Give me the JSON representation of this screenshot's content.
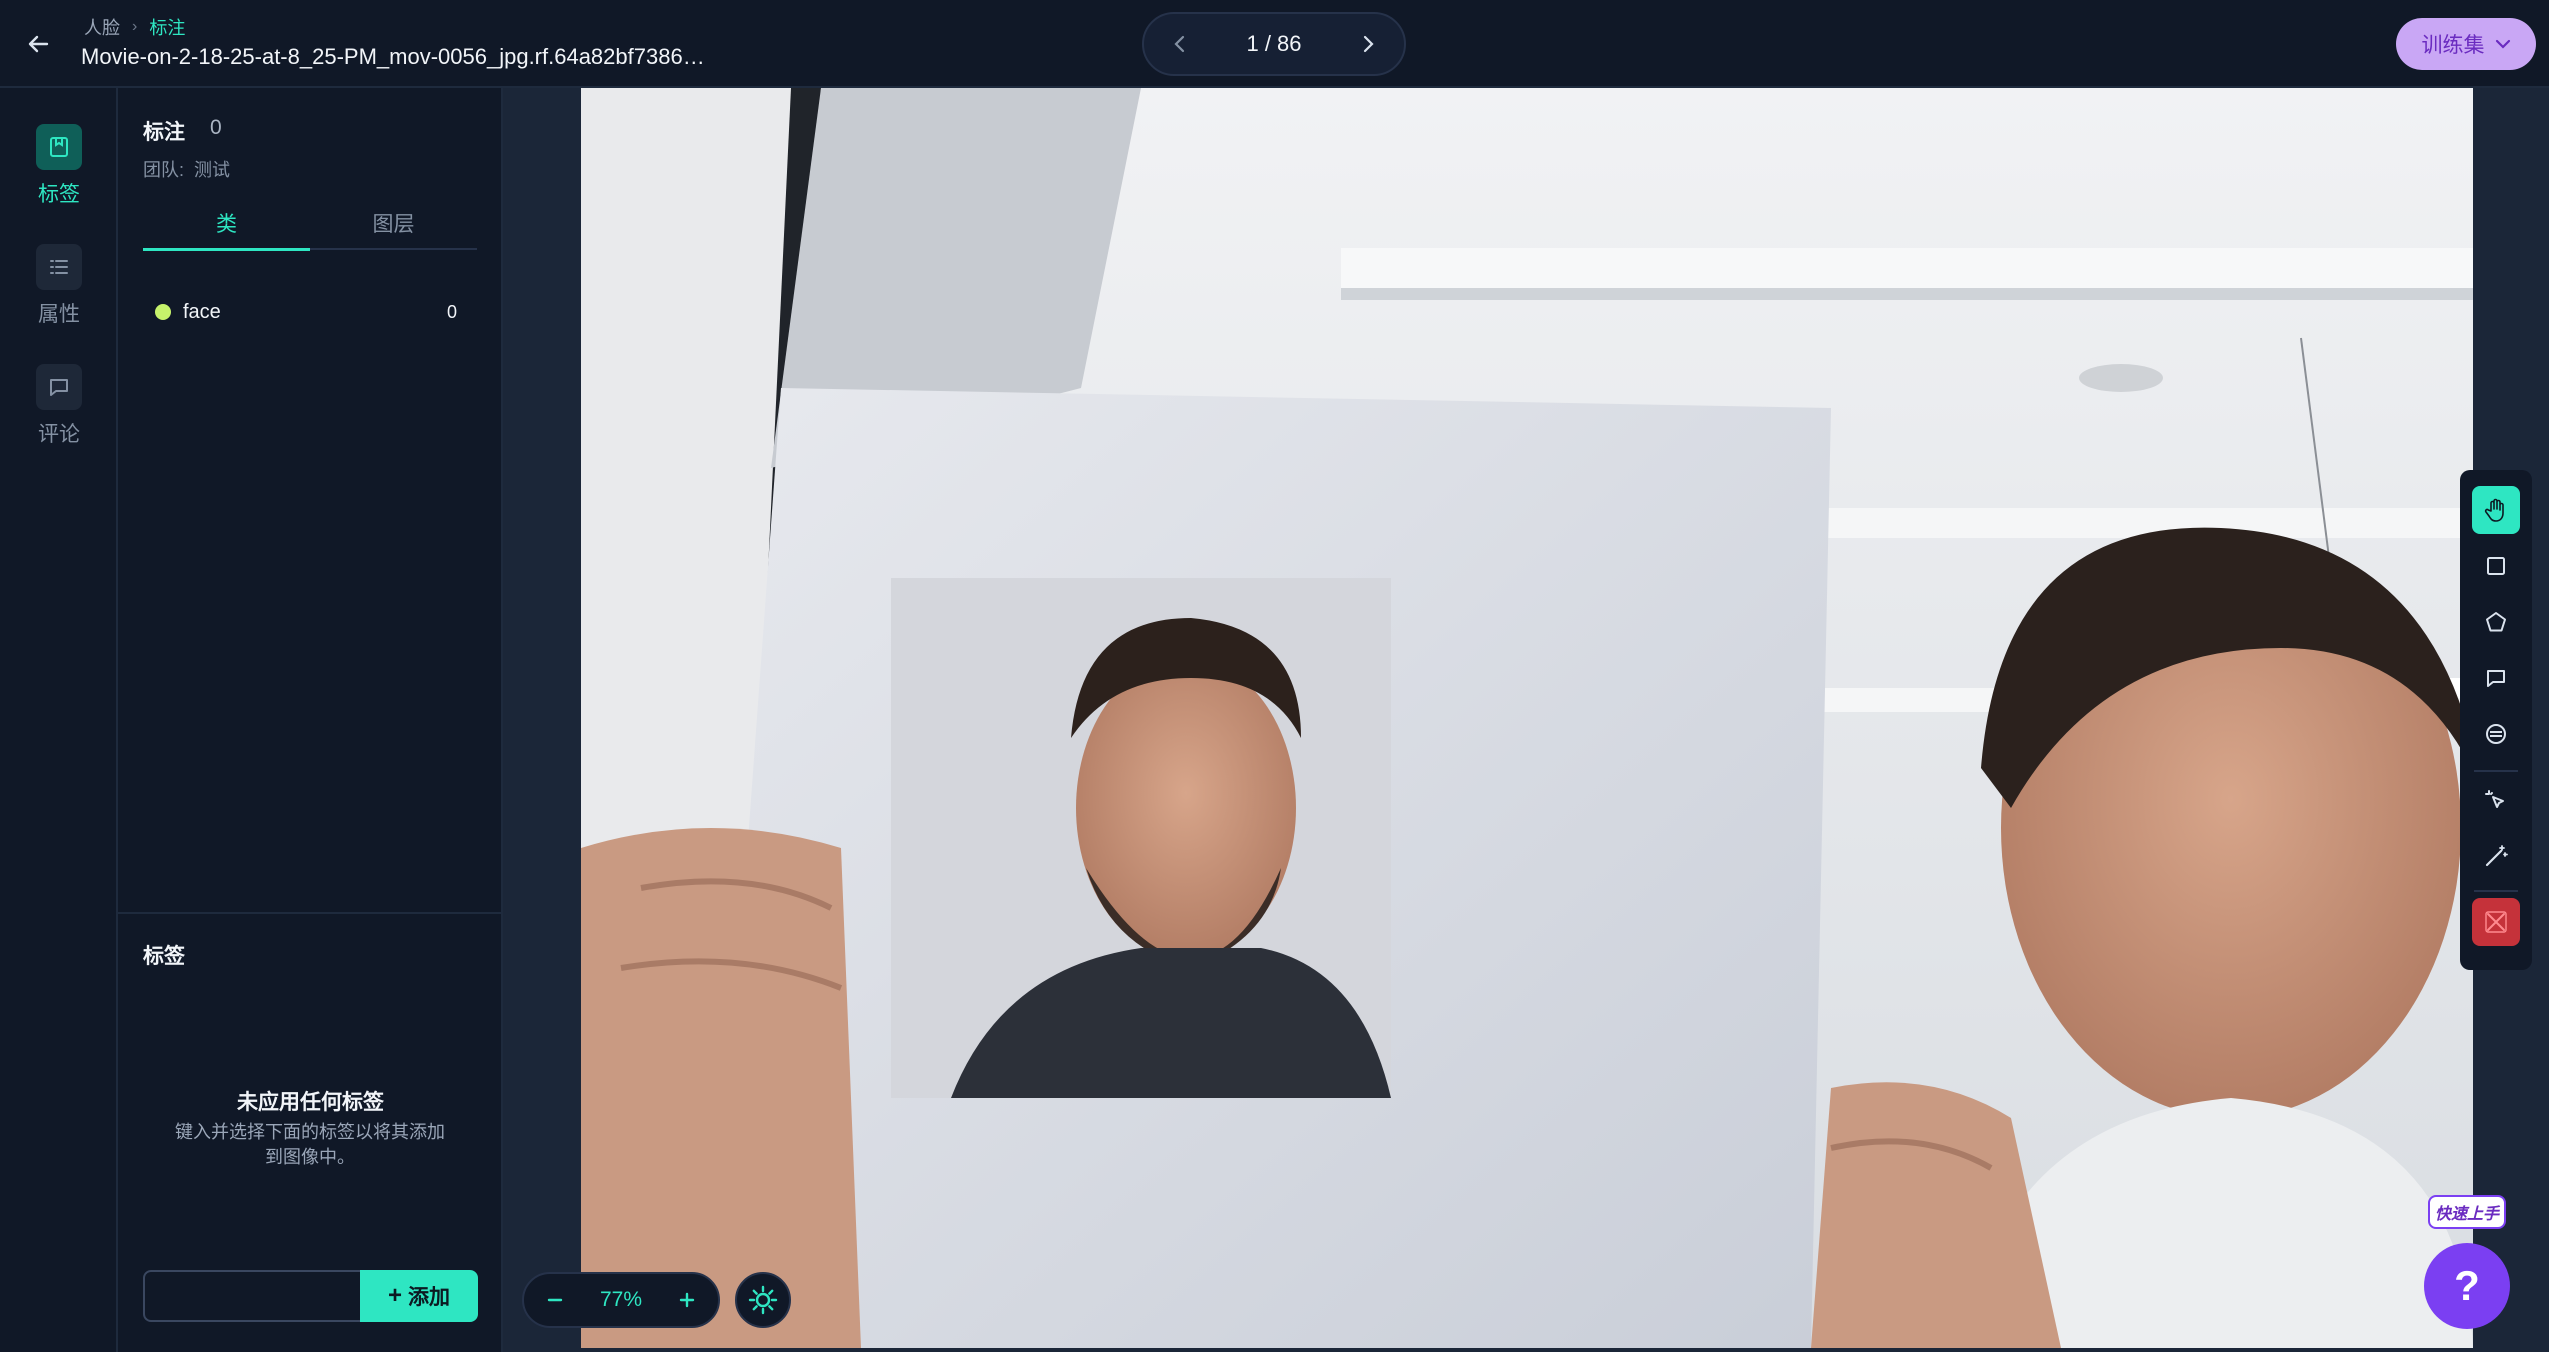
{
  "header": {
    "breadcrumb": [
      "人脸",
      "标注"
    ],
    "filename": "Movie-on-2-18-25-at-8_25-PM_mov-0056_jpg.rf.64a82bf7386…",
    "pager": "1 / 86",
    "dataset_button": "训练集"
  },
  "nav": {
    "items": [
      {
        "label": "标签",
        "icon": "tag-icon",
        "active": true
      },
      {
        "label": "属性",
        "icon": "list-icon",
        "active": false
      },
      {
        "label": "评论",
        "icon": "comment-icon",
        "active": false
      }
    ]
  },
  "panel": {
    "title": "标注",
    "count": "0",
    "team_label": "团队:",
    "team_value": "测试",
    "tabs": [
      "类",
      "图层"
    ],
    "classes": [
      {
        "name": "face",
        "count": "0",
        "color": "#c6f26b"
      }
    ],
    "tags_title": "标签",
    "empty_title": "未应用任何标签",
    "empty_desc": "键入并选择下面的标签以将其添加到图像中。",
    "add_button": "添加",
    "tag_input_value": ""
  },
  "canvas": {
    "zoom": "77%"
  },
  "toolbar": {
    "tools": [
      "hand-icon",
      "rectangle-icon",
      "polygon-icon",
      "comment-icon",
      "smart-select-icon",
      "magic-pointer-icon",
      "magic-wand-icon",
      "clear-icon"
    ]
  },
  "help": {
    "quick_start": "快速上手",
    "help_label": "?"
  },
  "colors": {
    "accent": "#2ee6c2",
    "purple": "#7b3ff2",
    "background": "#101827"
  }
}
